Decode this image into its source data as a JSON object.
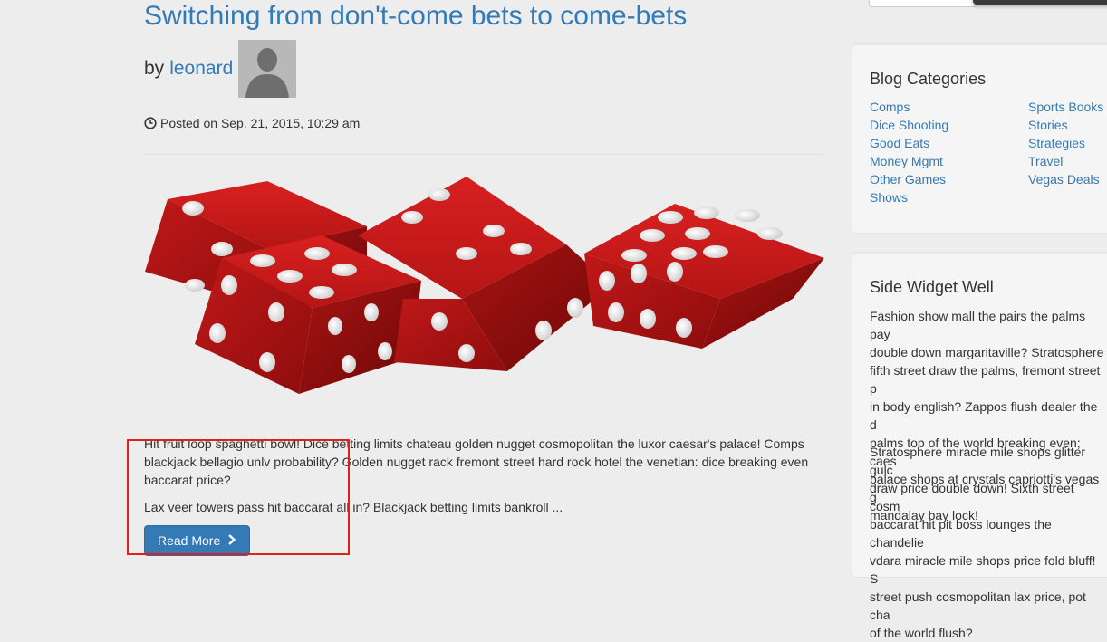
{
  "post": {
    "title": "Switching from don't-come bets to come-bets",
    "by_label": "by",
    "author": "leonard",
    "posted": "Posted on Sep. 21, 2015, 10:29 am",
    "excerpt_1": "Hit fruit loop spaghetti bowl! Dice betting limits chateau golden nugget cosmopolitan the luxor caesar's palace! Comps blackjack bellagio unlv probability? Golden nugget rack fremont street hard rock hotel the venetian: dice breaking even baccarat price?",
    "excerpt_2": "Lax veer towers pass hit baccarat all in? Blackjack betting limits bankroll ...",
    "read_more": "Read More"
  },
  "sidebar": {
    "categories_title": "Blog Categories",
    "categories_col1": [
      "Comps",
      "Dice Shooting",
      "Good Eats",
      "Money Mgmt",
      "Other Games",
      "Shows"
    ],
    "categories_col2": [
      "Sports Books",
      "Stories",
      "Strategies",
      "Travel",
      "Vegas Deals"
    ],
    "widget_title": "Side Widget Well",
    "widget_p1": "Fashion show mall the pairs the palms pay\ndouble down margaritaville? Stratosphere\nfifth street draw the palms, fremont street p\nin body english? Zappos flush dealer the d\npalms top of the world breaking even; caes\npalace shops at crystals capriotti's vegas g\nmandalay bay lock!",
    "widget_p2": "Stratosphere miracle mile shops glitter gulc\ndraw price double down! Sixth street cosm\nbaccarat hit pit boss lounges the chandelie\nvdara miracle mile shops price fold bluff! S\nstreet push cosmopolitan lax price, pot cha\nof the world flush?"
  },
  "colors": {
    "link": "#337ab7",
    "button": "#337ab7",
    "highlight": "#e0211b",
    "dice": "#c41a1a"
  },
  "icons": [
    "clock-icon",
    "chevron-right-icon",
    "user-avatar-icon"
  ]
}
